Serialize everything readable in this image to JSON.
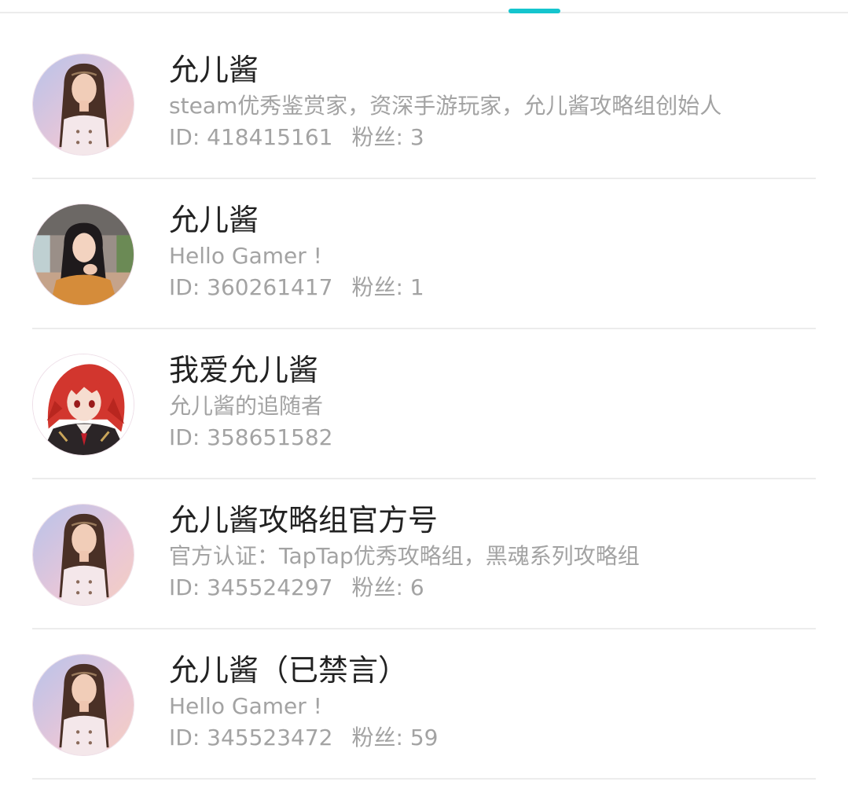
{
  "colors": {
    "accent": "#15c5ce",
    "name_text": "#222222",
    "secondary_text": "#a3a3a3",
    "divider": "#ececec"
  },
  "users": [
    {
      "name": "允儿酱",
      "bio": "steam优秀鉴赏家，资深手游玩家，允儿酱攻略组创始人",
      "id_text": "ID: 418415161",
      "fans_text": "粉丝: 3",
      "avatar": "girl-pink-dress-avatar"
    },
    {
      "name": "允儿酱",
      "bio": "Hello Gamer !",
      "id_text": "ID: 360261417",
      "fans_text": "粉丝: 1",
      "avatar": "girl-dark-hair-avatar"
    },
    {
      "name": "我爱允儿酱",
      "bio": "允儿酱的追随者",
      "id_text": "ID: 358651582",
      "fans_text": "",
      "avatar": "anime-red-hair-avatar"
    },
    {
      "name": "允儿酱攻略组官方号",
      "bio": "官方认证：TapTap优秀攻略组，黑魂系列攻略组",
      "id_text": "ID: 345524297",
      "fans_text": "粉丝: 6",
      "avatar": "girl-pink-dress-avatar"
    },
    {
      "name": "允儿酱（已禁言）",
      "bio": "Hello Gamer !",
      "id_text": "ID: 345523472",
      "fans_text": "粉丝: 59",
      "avatar": "girl-pink-dress-avatar"
    }
  ]
}
